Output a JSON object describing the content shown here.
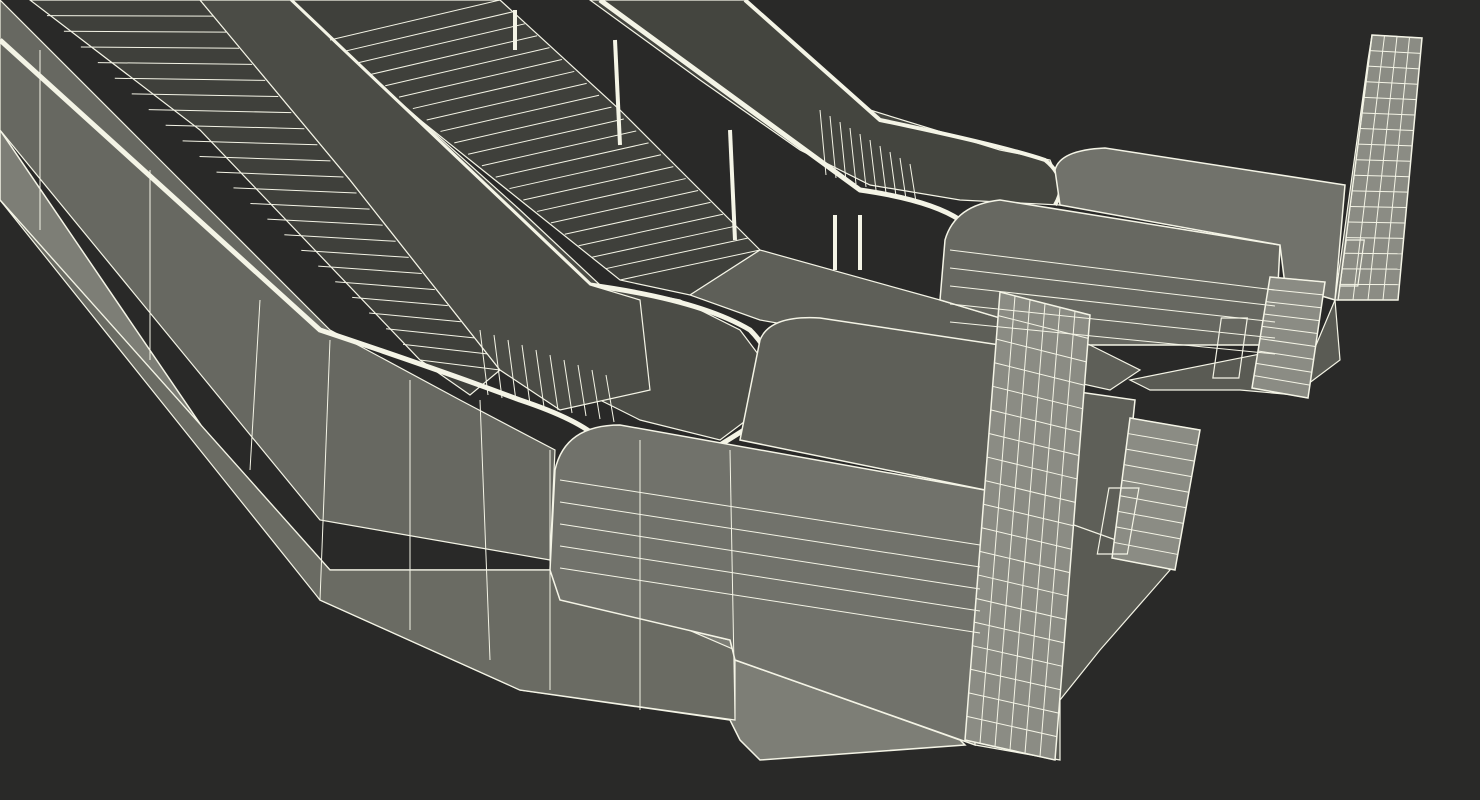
{
  "scene": {
    "subject": "escalator-pair-wireframe",
    "render_style": "wireframe-over-shaded",
    "colors": {
      "background": "#292928",
      "wire": "#f4f4e6",
      "side_panel": "#7d7e76",
      "side_panel_dark": "#6a6b63",
      "deck": "#5e5f58",
      "balustrade": "#4b4c46",
      "balustrade_far": "#44453f",
      "steps": "#3f403b",
      "floor_plate": "#676861",
      "pillar": "#8b8c84",
      "pillar_shade": "#72736c"
    }
  }
}
